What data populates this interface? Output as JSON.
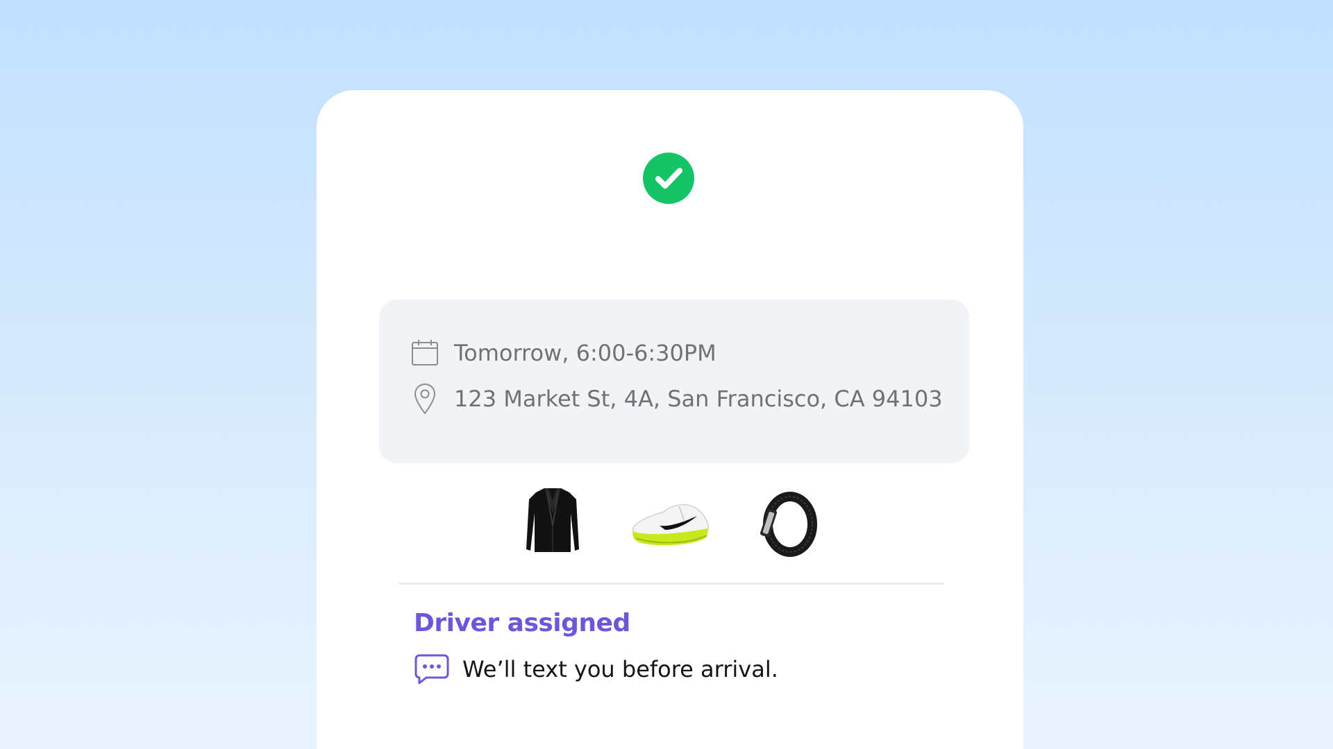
{
  "background_colors": [
    "#c1e0fe",
    "#e9f3fe"
  ],
  "status": {
    "icon": "check-circle-icon",
    "color": "#14c366"
  },
  "delivery": {
    "date_icon": "calendar-icon",
    "date_text": "Tomorrow, 6:00-6:30PM",
    "address_icon": "location-pin-icon",
    "address_text": "123 Market St, 4A, San Francisco, CA 94103"
  },
  "products": [
    {
      "icon": "blazer-image"
    },
    {
      "icon": "sneaker-image"
    },
    {
      "icon": "watch-band-image"
    }
  ],
  "driver": {
    "title": "Driver assigned",
    "title_color": "#6f54dc",
    "message_icon": "chat-bubble-icon",
    "message": "We’ll text you before arrival."
  }
}
